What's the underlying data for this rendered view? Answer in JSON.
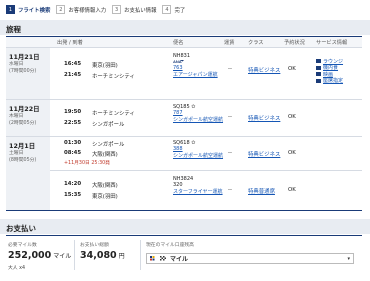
{
  "steps": [
    {
      "num": "1",
      "label": "フライト検索",
      "active": true
    },
    {
      "num": "2",
      "label": "お客様情報入力",
      "active": false
    },
    {
      "num": "3",
      "label": "お支払い情報",
      "active": false
    },
    {
      "num": "4",
      "label": "完了",
      "active": false
    }
  ],
  "itinerary": {
    "title": "旅程",
    "headers": {
      "route": "出発 / 到着",
      "flight": "便名",
      "status": "運賃",
      "class": "クラス",
      "booking": "予約状況",
      "service": "サービス情報"
    },
    "days": [
      {
        "date": "11月21日",
        "weekday": "水曜日",
        "duration": "(7時間00分)",
        "segments": [
          {
            "dep_time": "16:45",
            "dep_city": "東京(羽田)",
            "arr_time": "21:45",
            "arr_city": "ホーチミンシティ",
            "flight_no": "NH831",
            "aircraft": "763",
            "carrier": "エアージャパン運航",
            "fare": "--",
            "cabin": "特典ビジネス",
            "status": "OK",
            "services": [
              "ラウンジ",
              "機内食",
              "映画",
              "座席指定"
            ]
          }
        ]
      },
      {
        "date": "11月22日",
        "weekday": "木曜日",
        "duration": "(2時間05分)",
        "segments": [
          {
            "dep_time": "19:50",
            "dep_city": "ホーチミンシティ",
            "arr_time": "22:55",
            "arr_city": "シンガポール",
            "flight_no": "SQ185",
            "aircraft": "787",
            "carrier": "シンガポール航空運航",
            "fare": "--",
            "cabin": "特典ビジネス",
            "status": "OK",
            "services": []
          }
        ]
      },
      {
        "date": "12月1日",
        "weekday": "土曜日",
        "duration": "(8時間05分)",
        "segments": [
          {
            "dep_time": "01:30",
            "dep_city": "シンガポール",
            "arr_time": "08:45",
            "arr_city": "大阪(関西)",
            "alert": "+11月30日 25:30発",
            "flight_no": "SQ618",
            "aircraft": "388",
            "carrier": "シンガポール航空運航",
            "fare": "--",
            "cabin": "特典ビジネス",
            "status": "OK",
            "services": []
          },
          {
            "dep_time": "14:20",
            "dep_city": "大阪(関西)",
            "arr_time": "15:35",
            "arr_city": "東京(羽田)",
            "flight_no": "NH3824",
            "aircraft": "320",
            "carrier": "スターフライヤー運航",
            "fare": "--",
            "cabin": "特典普通席",
            "status": "OK",
            "services": []
          }
        ]
      }
    ]
  },
  "payment": {
    "title": "お支払い",
    "miles_label": "必要マイル数",
    "miles_value": "252,000",
    "miles_unit": "マイル",
    "miles_sub": "大人 x4",
    "taxes_label": "お支払い総額",
    "taxes_value": "34,080",
    "taxes_unit": "円",
    "program_label": "現在のマイル口座残高",
    "program_value": "マイル"
  },
  "colors": {
    "brand": "#1a3b78",
    "link": "#1556b5",
    "alert": "#c0392b"
  }
}
